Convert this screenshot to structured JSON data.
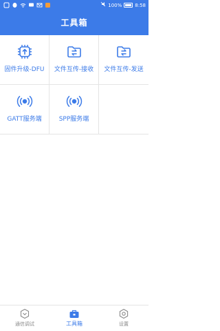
{
  "status_bar": {
    "battery": "100%",
    "time": "8:58"
  },
  "header": {
    "title": "工具箱"
  },
  "tools": [
    {
      "label": "固件升级-DFU",
      "icon": "firmware-chip-icon"
    },
    {
      "label": "文件互传-接收",
      "icon": "folder-transfer-icon"
    },
    {
      "label": "文件互传-发送",
      "icon": "folder-transfer-icon"
    },
    {
      "label": "GATT服务端",
      "icon": "ble-signal-icon"
    },
    {
      "label": "SPP服务端",
      "icon": "spp-signal-icon"
    }
  ],
  "tabs": [
    {
      "label": "通信调试",
      "icon": "shield-icon",
      "active": false
    },
    {
      "label": "工具箱",
      "icon": "toolbox-icon",
      "active": true
    },
    {
      "label": "设置",
      "icon": "gear-icon",
      "active": false
    }
  ],
  "colors": {
    "accent": "#3c7be8",
    "inactive": "#8a8a8a"
  }
}
